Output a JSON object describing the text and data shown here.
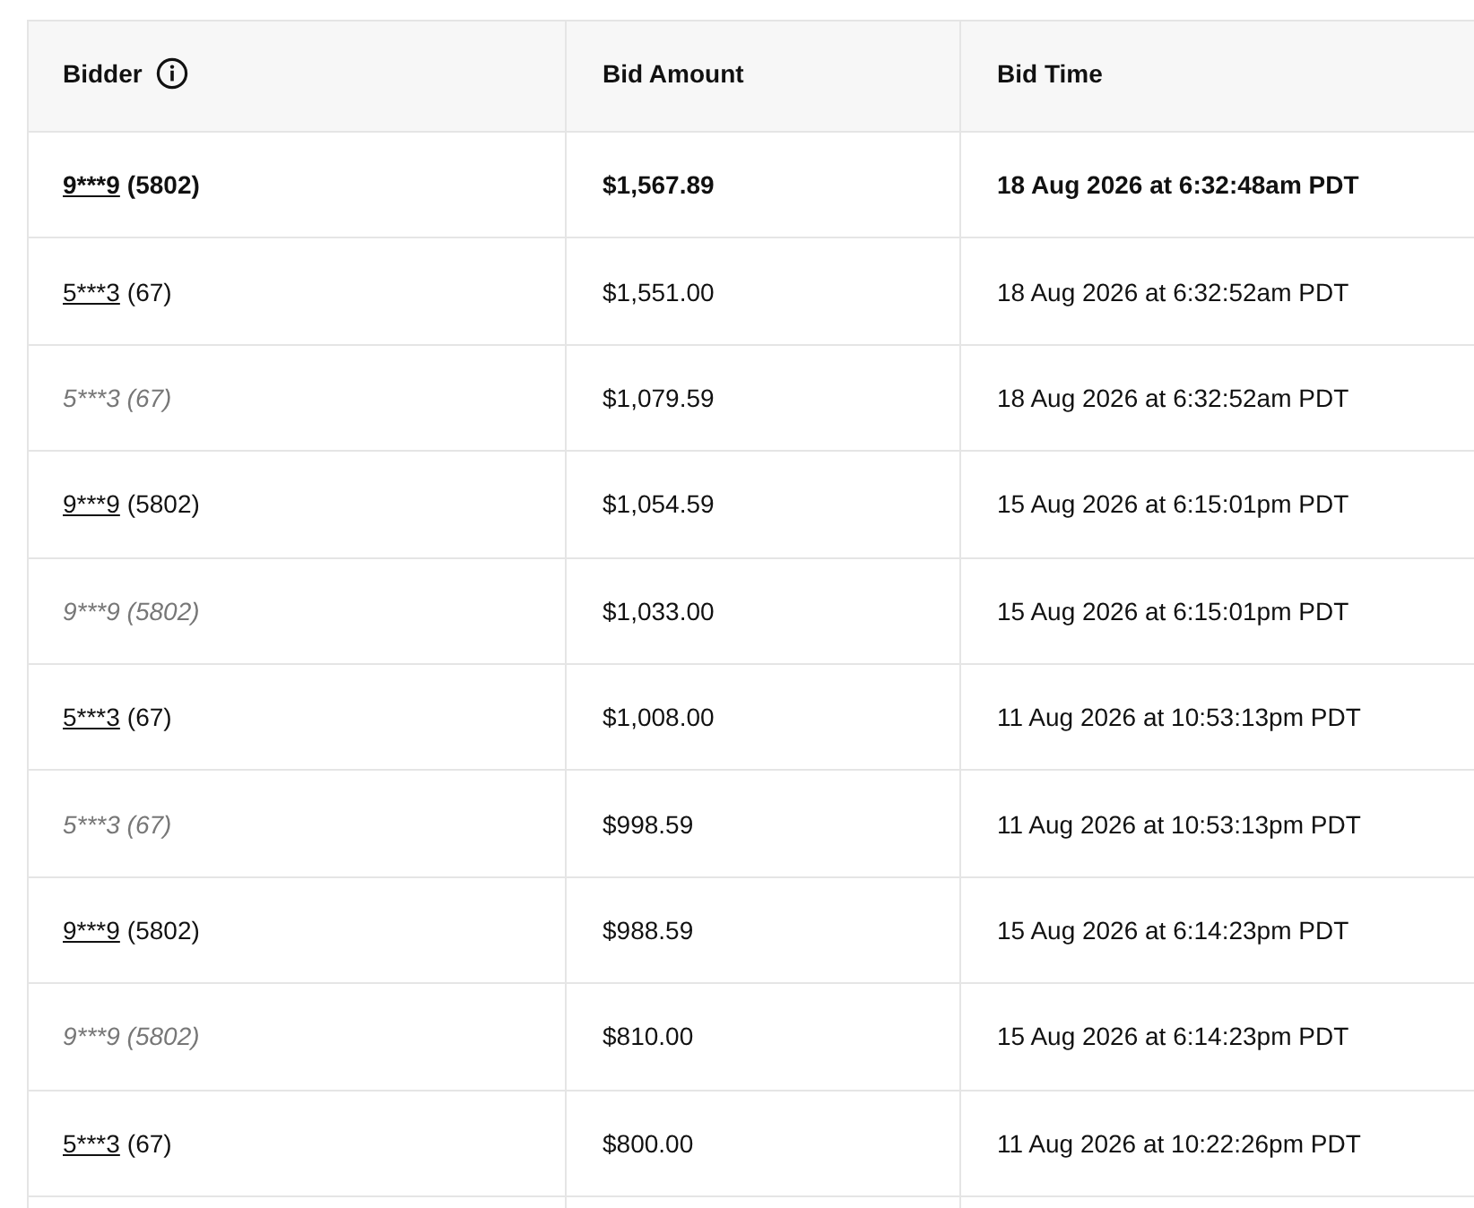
{
  "table": {
    "columns": [
      {
        "label": "Bidder",
        "info_icon": true
      },
      {
        "label": "Bid Amount",
        "info_icon": false
      },
      {
        "label": "Bid Time",
        "info_icon": false
      }
    ],
    "rows": [
      {
        "kind": "winning",
        "bidder": "9***9",
        "score": "(5802)",
        "amount": "$1,567.89",
        "time": "18 Aug 2026 at 6:32:48am PDT"
      },
      {
        "kind": "manual",
        "bidder": "5***3",
        "score": "(67)",
        "amount": "$1,551.00",
        "time": "18 Aug 2026 at 6:32:52am PDT"
      },
      {
        "kind": "auto",
        "bidder": "5***3",
        "score": "(67)",
        "amount": "$1,079.59",
        "time": "18 Aug 2026 at 6:32:52am PDT"
      },
      {
        "kind": "manual",
        "bidder": "9***9",
        "score": "(5802)",
        "amount": "$1,054.59",
        "time": "15 Aug 2026 at 6:15:01pm PDT"
      },
      {
        "kind": "auto",
        "bidder": "9***9",
        "score": "(5802)",
        "amount": "$1,033.00",
        "time": "15 Aug 2026 at 6:15:01pm PDT"
      },
      {
        "kind": "manual",
        "bidder": "5***3",
        "score": "(67)",
        "amount": "$1,008.00",
        "time": "11 Aug 2026 at 10:53:13pm PDT"
      },
      {
        "kind": "auto",
        "bidder": "5***3",
        "score": "(67)",
        "amount": "$998.59",
        "time": "11 Aug 2026 at 10:53:13pm PDT"
      },
      {
        "kind": "manual",
        "bidder": "9***9",
        "score": "(5802)",
        "amount": "$988.59",
        "time": "15 Aug 2026 at 6:14:23pm PDT"
      },
      {
        "kind": "auto",
        "bidder": "9***9",
        "score": "(5802)",
        "amount": "$810.00",
        "time": "15 Aug 2026 at 6:14:23pm PDT"
      },
      {
        "kind": "manual",
        "bidder": "5***3",
        "score": "(67)",
        "amount": "$800.00",
        "time": "11 Aug 2026 at 10:22:26pm PDT"
      }
    ]
  }
}
